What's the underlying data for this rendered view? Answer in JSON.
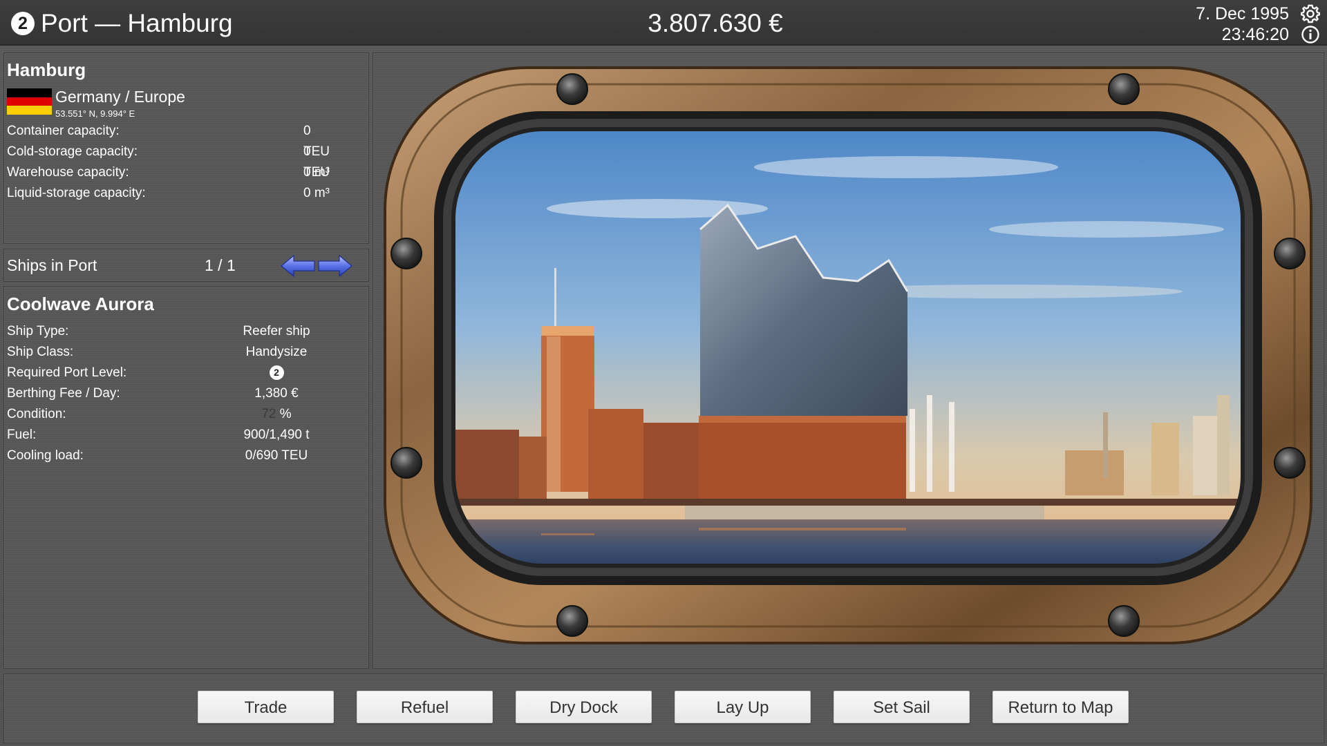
{
  "header": {
    "port_level": "2",
    "title": "Port — Hamburg",
    "money": "3.807.630 €",
    "date": "7. Dec 1995",
    "time": "23:46:20",
    "settings_icon": "gear-icon",
    "info_icon": "info-icon"
  },
  "port": {
    "name": "Hamburg",
    "country": "Germany / Europe",
    "coordinates": "53.551° N, 9.994° E",
    "flag_colors": [
      "#000000",
      "#dd0000",
      "#ffce00"
    ],
    "capacities": [
      {
        "label": "Container capacity:",
        "value": "0 TEU"
      },
      {
        "label": "Cold-storage capacity:",
        "value": "0 TEU"
      },
      {
        "label": "Warehouse capacity:",
        "value": "0 m³"
      },
      {
        "label": "Liquid-storage capacity:",
        "value": "0 m³"
      }
    ]
  },
  "ships_in_port": {
    "label": "Ships in Port",
    "count": "1 / 1",
    "prev_icon": "arrow-left-icon",
    "next_icon": "arrow-right-icon"
  },
  "ship": {
    "name": "Coolwave Aurora",
    "type_label": "Ship Type:",
    "type_value": "Reefer ship",
    "class_label": "Ship Class:",
    "class_value": "Handysize",
    "port_level_label": "Required Port Level:",
    "port_level_value": "2",
    "fee_label": "Berthing Fee / Day:",
    "fee_value": "1,380 €",
    "condition_label": "Condition:",
    "condition_value": "72",
    "condition_unit": "%",
    "fuel_label": "Fuel:",
    "fuel_value": "900/1,490 t",
    "cooling_label": "Cooling load:",
    "cooling_value": "0/690 TEU"
  },
  "actions": {
    "trade": "Trade",
    "refuel": "Refuel",
    "dry_dock": "Dry Dock",
    "lay_up": "Lay Up",
    "set_sail": "Set Sail",
    "return_to_map": "Return to Map"
  },
  "colors": {
    "frame_bronze": "#8a6a46",
    "button_bg": "#f0f0f0",
    "nav_arrow": "#4a63d8"
  }
}
